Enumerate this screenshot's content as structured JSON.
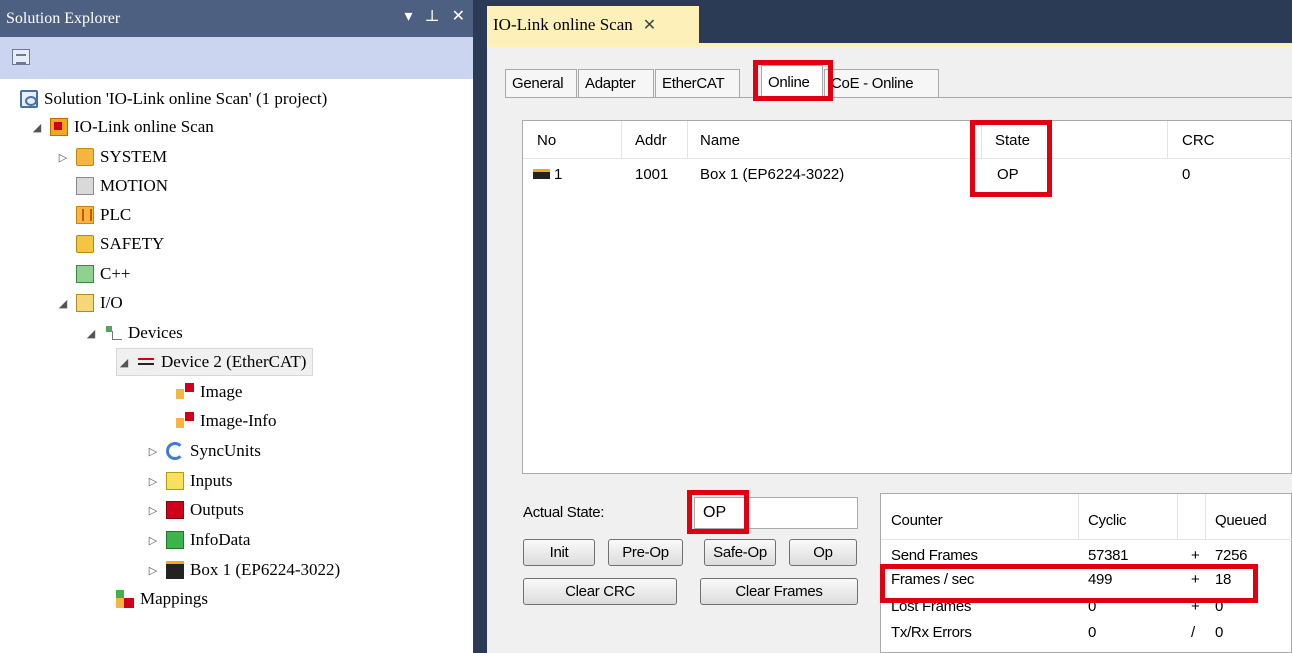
{
  "solution_explorer": {
    "title": "Solution Explorer",
    "title_controls": [
      "▾",
      "⊥",
      "✕"
    ],
    "tree": [
      {
        "label": "Solution 'IO-Link online Scan' (1 project)",
        "icon": "solution-icon"
      },
      {
        "label": "IO-Link online Scan",
        "icon": "project-icon"
      },
      {
        "label": "SYSTEM",
        "icon": "system-icon"
      },
      {
        "label": "MOTION",
        "icon": "motion-icon"
      },
      {
        "label": "PLC",
        "icon": "plc-icon"
      },
      {
        "label": "SAFETY",
        "icon": "safety-icon"
      },
      {
        "label": "C++",
        "icon": "cpp-icon"
      },
      {
        "label": "I/O",
        "icon": "io-icon"
      },
      {
        "label": "Devices",
        "icon": "devices-icon"
      },
      {
        "label": "Device 2 (EtherCAT)",
        "icon": "ethercat-device-icon"
      },
      {
        "label": "Image",
        "icon": "image-icon"
      },
      {
        "label": "Image-Info",
        "icon": "image-info-icon"
      },
      {
        "label": "SyncUnits",
        "icon": "sync-units-icon"
      },
      {
        "label": "Inputs",
        "icon": "inputs-icon"
      },
      {
        "label": "Outputs",
        "icon": "outputs-icon"
      },
      {
        "label": "InfoData",
        "icon": "info-data-icon"
      },
      {
        "label": "Box 1 (EP6224-3022)",
        "icon": "box-icon"
      },
      {
        "label": "Mappings",
        "icon": "mappings-icon"
      }
    ],
    "expand_glyph": "▷",
    "collapse_glyph": "◢"
  },
  "document": {
    "tab_title": "IO-Link online Scan",
    "tab_close": "✕",
    "tabs": [
      "General",
      "Adapter",
      "EtherCAT",
      "Online",
      "CoE - Online"
    ],
    "active_tab": "Online",
    "device_list": {
      "columns": [
        "No",
        "Addr",
        "Name",
        "State",
        "CRC"
      ],
      "rows": [
        {
          "no": "1",
          "addr": "1001",
          "name": "Box 1 (EP6224-3022)",
          "state": "OP",
          "crc": "0"
        }
      ]
    },
    "actual_state_label": "Actual State:",
    "actual_state_value": "OP",
    "buttons": {
      "init": "Init",
      "pre_op": "Pre-Op",
      "safe_op": "Safe-Op",
      "op": "Op",
      "clear_crc": "Clear CRC",
      "clear_frames": "Clear Frames"
    },
    "counters": {
      "headers": [
        "Counter",
        "Cyclic",
        "Queued"
      ],
      "rows": [
        {
          "name": "Send Frames",
          "cyclic": "57381",
          "op": "+",
          "queued": "7256"
        },
        {
          "name": "Frames / sec",
          "cyclic": "499",
          "op": "+",
          "queued": "18"
        },
        {
          "name": "Lost Frames",
          "cyclic": "0",
          "op": "+",
          "queued": "0"
        },
        {
          "name": "Tx/Rx Errors",
          "cyclic": "0",
          "op": "/",
          "queued": "0"
        }
      ]
    }
  },
  "colors": {
    "highlight": "#e0000f",
    "panel_title": "#4d6082",
    "doc_tab": "#fdf0b8"
  }
}
